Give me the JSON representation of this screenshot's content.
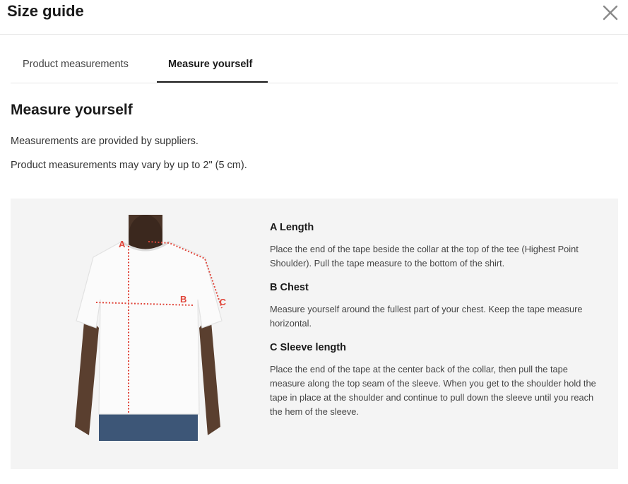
{
  "header": {
    "title": "Size guide",
    "close_icon": "close-icon"
  },
  "tabs": [
    {
      "label": "Product measurements",
      "active": false
    },
    {
      "label": "Measure yourself",
      "active": true
    }
  ],
  "section": {
    "heading": "Measure yourself",
    "lines": [
      "Measurements are provided by suppliers.",
      "Product measurements may vary by up to 2\" (5 cm)."
    ]
  },
  "figure": {
    "markers": [
      "A",
      "B",
      "C"
    ],
    "marker_color": "#e0453a"
  },
  "measurements": [
    {
      "title": "A Length",
      "text": "Place the end of the tape beside the collar at the top of the tee (Highest Point Shoulder). Pull the tape measure to the bottom of the shirt."
    },
    {
      "title": "B Chest",
      "text": "Measure yourself around the fullest part of your chest. Keep the tape measure horizontal."
    },
    {
      "title": "C Sleeve length",
      "text": "Place the end of the tape at the center back of the collar, then pull the tape measure along the top seam of the sleeve. When you get to the shoulder hold the tape in place at the shoulder and continue to pull down the sleeve until you reach the hem of the sleeve."
    }
  ]
}
